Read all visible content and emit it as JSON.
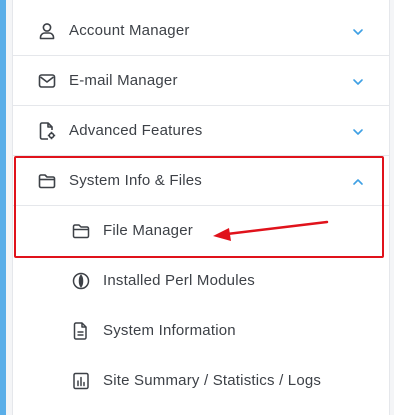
{
  "colors": {
    "accent_blue": "#5aaee8",
    "chevron_blue": "#3ea0e4",
    "text": "#3d4147",
    "annotation_red": "#e0121b"
  },
  "menu": {
    "items": [
      {
        "label": "Account Manager",
        "icon": "user-icon",
        "expanded": false
      },
      {
        "label": "E-mail Manager",
        "icon": "envelope-icon",
        "expanded": false
      },
      {
        "label": "Advanced Features",
        "icon": "document-gear-icon",
        "expanded": false
      },
      {
        "label": "System Info & Files",
        "icon": "folder-icon",
        "expanded": true
      }
    ],
    "subitems": [
      {
        "label": "File Manager",
        "icon": "folder-icon"
      },
      {
        "label": "Installed Perl Modules",
        "icon": "perl-icon"
      },
      {
        "label": "System Information",
        "icon": "document-icon"
      },
      {
        "label": "Site Summary / Statistics / Logs",
        "icon": "bar-chart-icon"
      }
    ]
  }
}
